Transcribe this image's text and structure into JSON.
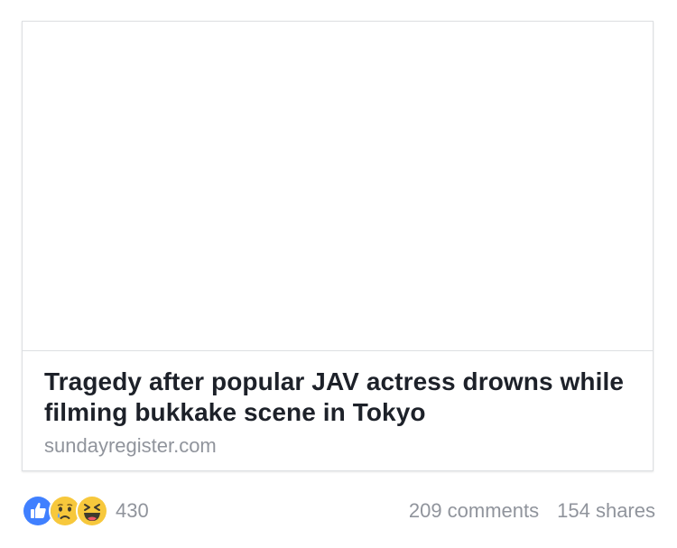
{
  "post": {
    "headline": "Tragedy after popular JAV actress drowns while filming bukkake scene in Tokyo",
    "domain": "sundayregister.com"
  },
  "reactions": {
    "icons": [
      "like-icon",
      "sad-icon",
      "haha-icon"
    ],
    "count": "430"
  },
  "stats": {
    "comments": "209 comments",
    "shares": "154 shares"
  },
  "colors": {
    "like_blue": "#4080ff",
    "emoji_yellow": "#f7c83c",
    "text_dark": "#1d2129",
    "text_grey": "#90949c",
    "border": "#dddfe2"
  }
}
